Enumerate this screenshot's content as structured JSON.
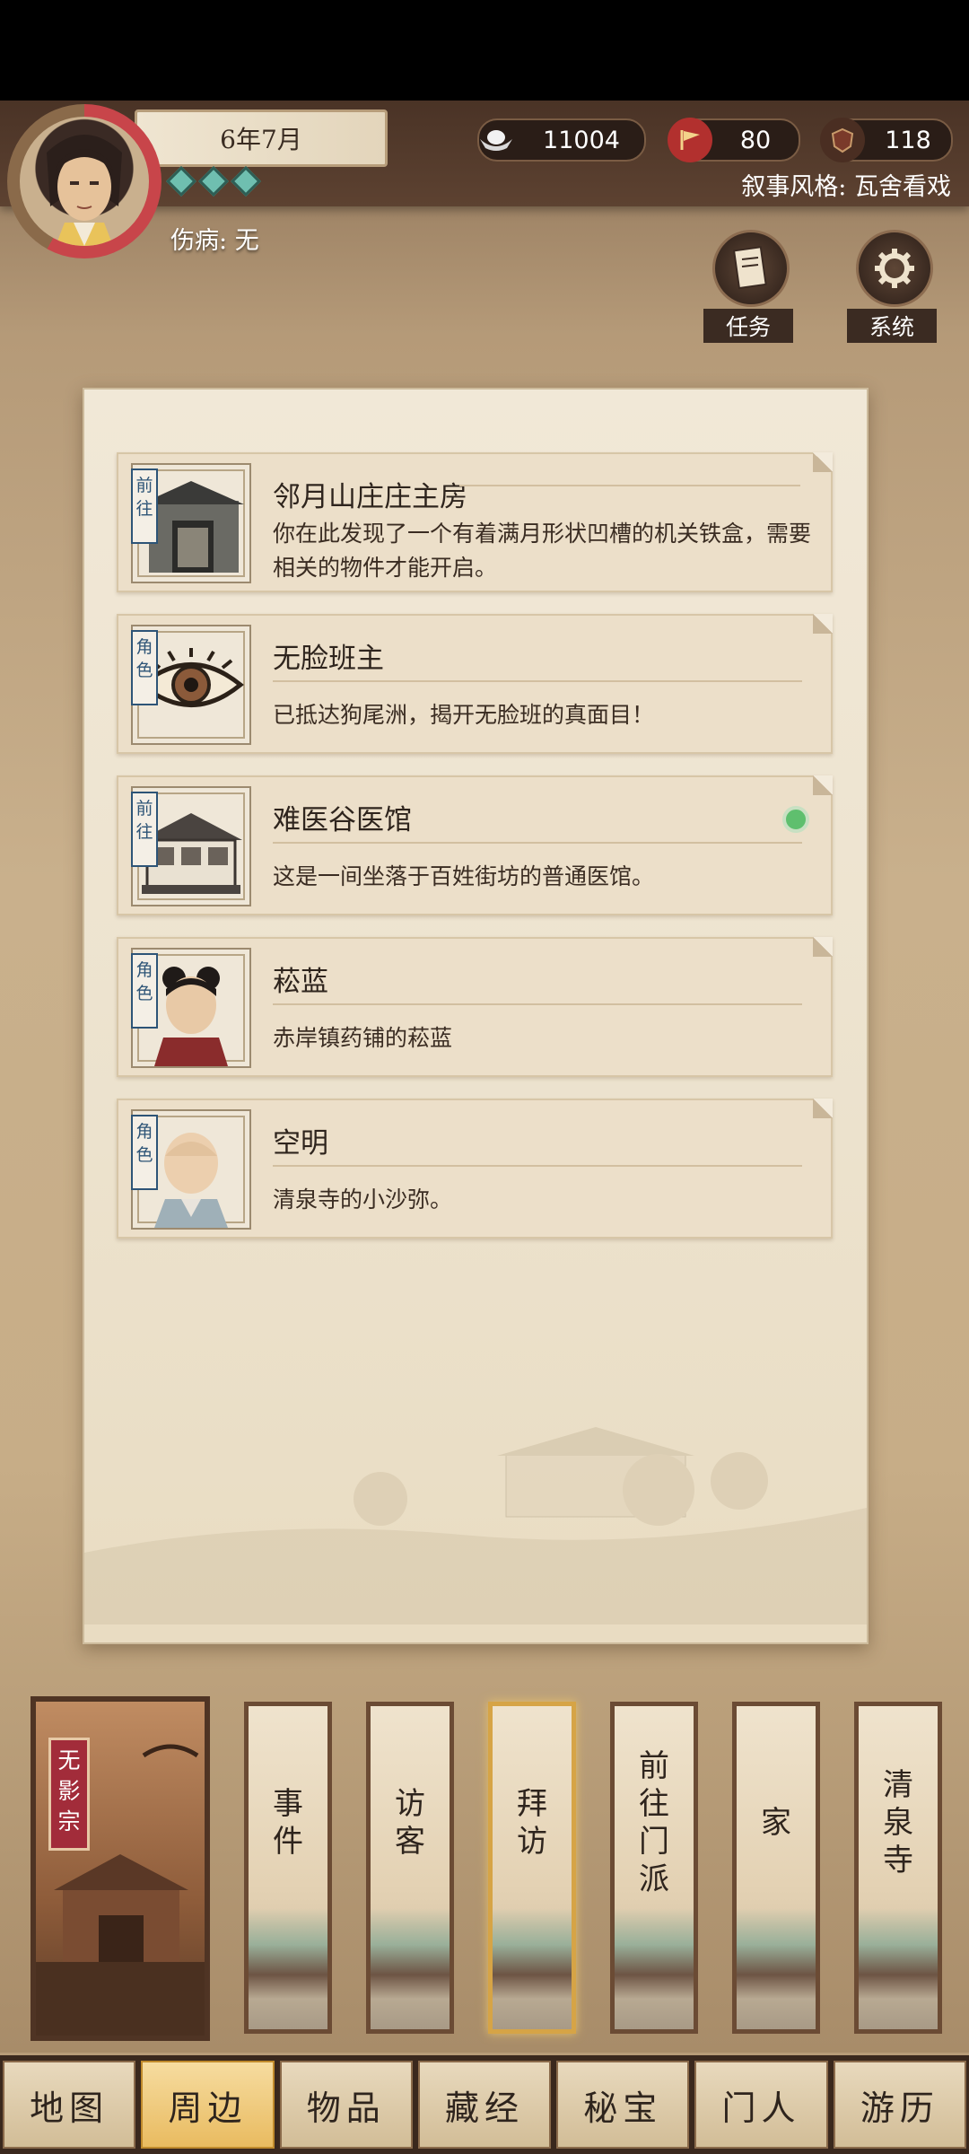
{
  "header": {
    "date": "6年7月",
    "injury_label": "伤病:",
    "injury_value": "无",
    "narrative_style_label": "叙事风格:",
    "narrative_style_value": "瓦舍看戏"
  },
  "resources": {
    "silver": "11004",
    "flag": "80",
    "shield": "118"
  },
  "buttons": {
    "tasks": "任务",
    "system": "系统"
  },
  "cards": [
    {
      "tag": "前往",
      "title": "邻月山庄庄主房",
      "desc": "你在此发现了一个有着满月形状凹槽的机关铁盒，需要相关的物件才能开启。"
    },
    {
      "tag": "角色",
      "title": "无脸班主",
      "desc": "已抵达狗尾洲，揭开无脸班的真面目！"
    },
    {
      "tag": "前往",
      "title": "难医谷医馆",
      "desc": "这是一间坐落于百姓街坊的普通医馆。"
    },
    {
      "tag": "角色",
      "title": "菘蓝",
      "desc": "赤岸镇药铺的菘蓝"
    },
    {
      "tag": "角色",
      "title": "空明",
      "desc": "清泉寺的小沙弥。"
    }
  ],
  "sect": {
    "name": "无影宗"
  },
  "scrolls": [
    "事件",
    "访客",
    "拜访",
    "前往门派",
    "家",
    "清泉寺"
  ],
  "nav": [
    "地图",
    "周边",
    "物品",
    "藏经",
    "秘宝",
    "门人",
    "游历"
  ],
  "icons": {
    "silver": "silver-ingot-icon",
    "flag": "red-flag-icon",
    "shield": "badge-icon",
    "tasks": "scroll-notes-icon",
    "system": "gear-icon"
  },
  "colors": {
    "accent": "#e9bb60",
    "hud": "#4a3326",
    "tag_blue": "#2d5477",
    "sect_red": "#a22c3a"
  }
}
